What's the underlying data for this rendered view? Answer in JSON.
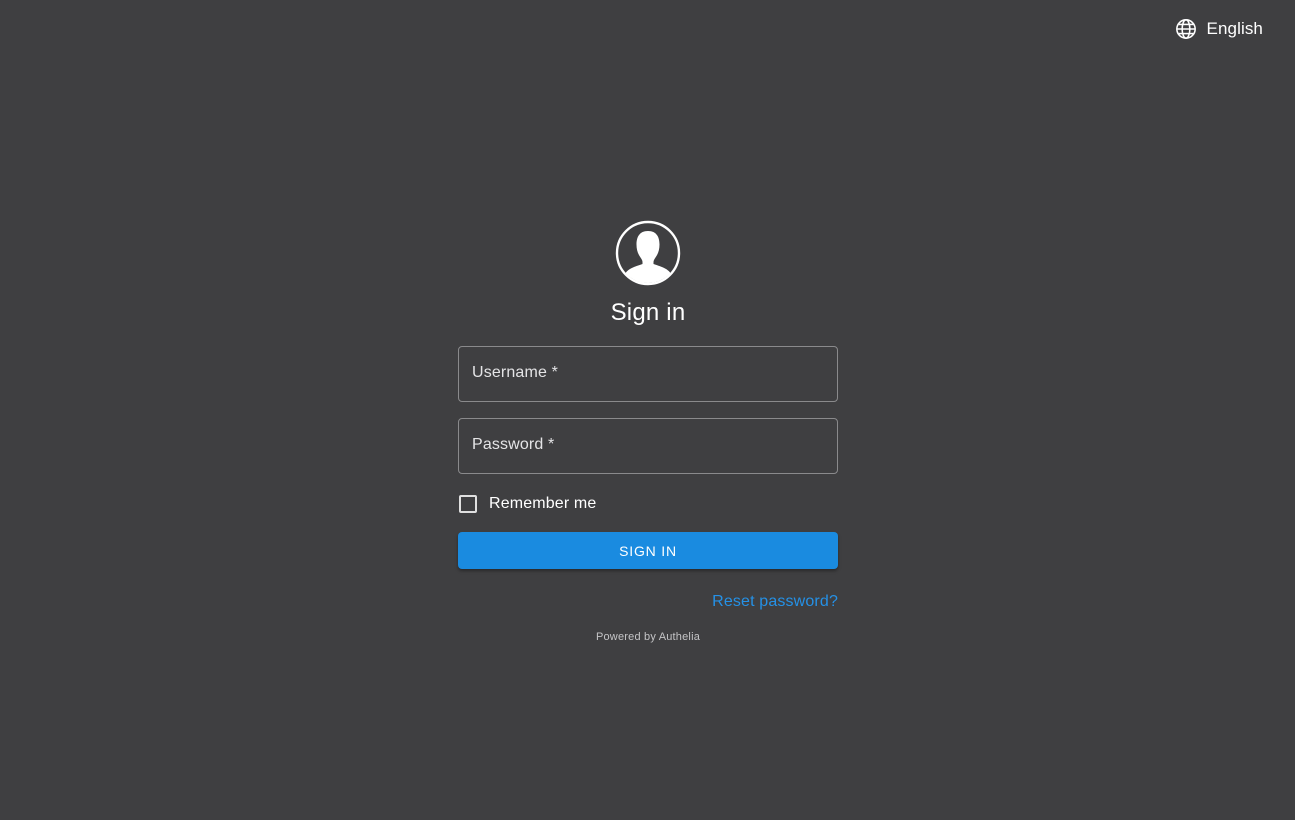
{
  "header": {
    "language_icon": "globe-icon",
    "language_label": "English"
  },
  "login": {
    "avatar_icon": "user-avatar-icon",
    "title": "Sign in",
    "username": {
      "label": "Username *",
      "value": ""
    },
    "password": {
      "label": "Password *",
      "value": ""
    },
    "remember_me": {
      "label": "Remember me",
      "checked": false
    },
    "submit_label": "SIGN IN",
    "reset_password_label": "Reset password?"
  },
  "footer": {
    "powered_by": "Powered by Authelia"
  },
  "colors": {
    "background": "#3f3f41",
    "primary": "#1a8be0",
    "link": "#2591e6",
    "text": "#ffffff"
  }
}
